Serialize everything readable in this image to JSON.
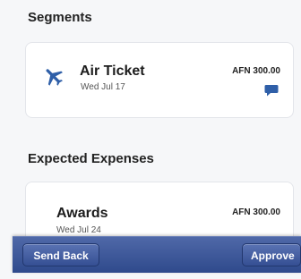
{
  "segments": {
    "title": "Segments",
    "items": [
      {
        "icon": "airplane-icon",
        "label": "Air Ticket",
        "date": "Wed Jul 17",
        "amount": "AFN 300.00",
        "has_comment": true
      }
    ]
  },
  "expenses": {
    "title": "Expected Expenses",
    "items": [
      {
        "label": "Awards",
        "date": "Wed Jul 24",
        "amount": "AFN 300.00"
      }
    ]
  },
  "toolbar": {
    "send_back_label": "Send Back",
    "approve_label": "Approve"
  },
  "colors": {
    "accent_blue": "#2f5fa8",
    "toolbar": "#3a5396"
  }
}
